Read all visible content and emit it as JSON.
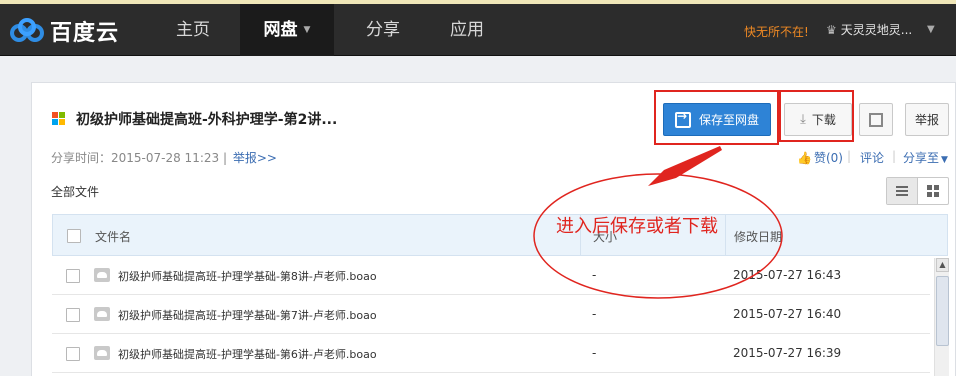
{
  "nav": {
    "logo_text": "百度云",
    "items": [
      {
        "label": "主页"
      },
      {
        "label": "网盘"
      },
      {
        "label": "分享"
      },
      {
        "label": "应用"
      }
    ],
    "promo_link": "快无所不在!",
    "username": "天灵灵地灵...",
    "user_badge": "♛"
  },
  "share": {
    "title": "初级护师基础提高班-外科护理学-第2讲...",
    "meta_label": "分享时间：2015-07-28 11:23",
    "meta_sep": "|",
    "report_link": "举报>>",
    "all_files": "全部文件"
  },
  "actions": {
    "save_label": "保存至网盘",
    "download_label": "下载",
    "report_label": "举报",
    "like_label": "赞(0)",
    "comment_label": "评论",
    "share_to_label": "分享至",
    "sep": "|"
  },
  "table": {
    "headers": {
      "name": "文件名",
      "size": "大小",
      "date": "修改日期"
    },
    "rows": [
      {
        "name": "初级护师基础提高班-护理学基础-第8讲-卢老师.boao",
        "size": "-",
        "date": "2015-07-27 16:43"
      },
      {
        "name": "初级护师基础提高班-护理学基础-第7讲-卢老师.boao",
        "size": "-",
        "date": "2015-07-27 16:40"
      },
      {
        "name": "初级护师基础提高班-护理学基础-第6讲-卢老师.boao",
        "size": "-",
        "date": "2015-07-27 16:39"
      }
    ]
  },
  "annotation": {
    "text": "进入后保存或者下载",
    "color": "#e0251f"
  },
  "colors": {
    "nav_bg": "#2c2c2c",
    "accent_blue": "#2e83d6",
    "link_blue": "#3b6db2",
    "promo_orange": "#f08a24",
    "annotation_red": "#e0251f"
  },
  "icons": [
    "baidu-cloud-logo-icon",
    "chevron-down-icon",
    "windows-logo-icon",
    "save-to-disk-icon",
    "download-icon",
    "qrcode-icon",
    "thumbs-up-icon",
    "list-view-icon",
    "grid-view-icon",
    "cloud-file-icon"
  ]
}
